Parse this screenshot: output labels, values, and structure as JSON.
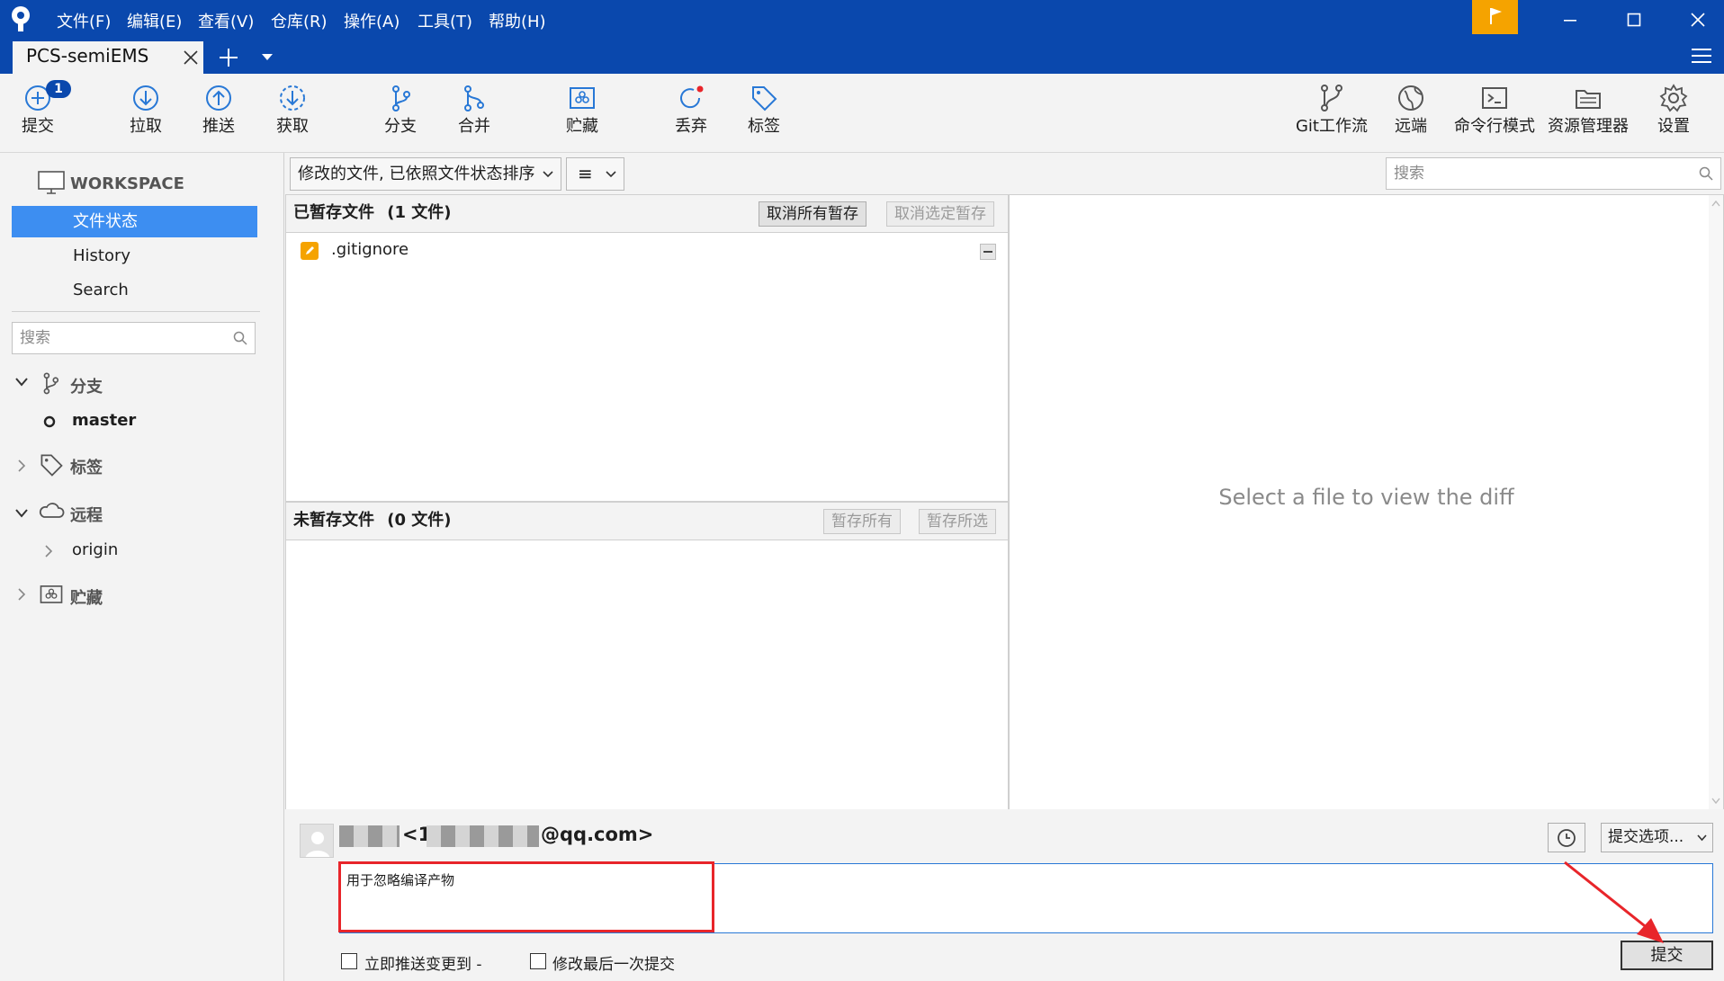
{
  "titlebar": {
    "menu": [
      "文件(F)",
      "编辑(E)",
      "查看(V)",
      "仓库(R)",
      "操作(A)",
      "工具(T)",
      "帮助(H)"
    ],
    "tab_name": "PCS-semiEMS",
    "accent": "#0a48ad",
    "flag_color": "#f5a300"
  },
  "toolbar": {
    "commit": "提交",
    "commit_badge": "1",
    "pull": "拉取",
    "push": "推送",
    "fetch": "获取",
    "branch": "分支",
    "merge": "合并",
    "stash": "贮藏",
    "discard": "丢弃",
    "tag": "标签",
    "gitflow": "Git工作流",
    "remote": "远端",
    "terminal": "命令行模式",
    "explorer": "资源管理器",
    "settings": "设置"
  },
  "sidebar": {
    "workspace": "WORKSPACE",
    "items": [
      "文件状态",
      "History",
      "Search"
    ],
    "search_placeholder": "搜索",
    "branches": "分支",
    "current_branch": "master",
    "tags": "标签",
    "remotes": "远程",
    "origin": "origin",
    "stashes": "贮藏"
  },
  "filter": {
    "sort_label": "修改的文件, 已依照文件状态排序",
    "view_icon": "≡",
    "search_placeholder": "搜索"
  },
  "staged": {
    "title": "已暂存文件",
    "count": "(1 文件)",
    "unstage_all": "取消所有暂存",
    "unstage_selected": "取消选定暂存",
    "files": [
      ".gitignore"
    ]
  },
  "unstaged": {
    "title": "未暂存文件",
    "count": "(0 文件)",
    "stage_all": "暂存所有",
    "stage_selected": "暂存所选"
  },
  "diff": {
    "placeholder": "Select a file to view the diff"
  },
  "commit": {
    "author_prefix": "<1",
    "author_suffix": "@qq.com>",
    "message": "用于忽略编译产物",
    "options": "提交选项...",
    "push_immediately": "立即推送变更到 -",
    "amend": "修改最后一次提交",
    "submit": "提交",
    "highlight_color": "#e8252a"
  }
}
